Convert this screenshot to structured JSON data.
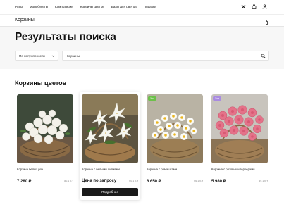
{
  "nav": [
    "Розы",
    "Монобукеты",
    "Композиции",
    "Корзины цветов",
    "Вазы для цветов",
    "Подарки"
  ],
  "search": {
    "query": "Корзины"
  },
  "page_title": "Результаты поиска",
  "filters": {
    "sort_value": "По популярности",
    "query_value": "Корзины"
  },
  "section_title": "Корзины цветов",
  "products": [
    {
      "name": "Корзина белых роз",
      "price": "7 280 ₽",
      "points": "80.1 б.т",
      "badge": "",
      "progress": 0.25
    },
    {
      "name": "Корзина с белыми лилиями",
      "price": "Цена по запросу",
      "points": "60.1 б.т",
      "badge": "",
      "progress": 0.25,
      "button": "Подробнее"
    },
    {
      "name": "Корзина с ромашками",
      "price": "6 650 ₽",
      "points": "66.1 б.т",
      "badge": "Хит",
      "badge_color": "#6cc04a",
      "progress": 0.25
    },
    {
      "name": "Корзина с розовыми герберами",
      "price": "5 980 ₽",
      "points": "49.1 б.т",
      "badge": "Хит",
      "badge_color": "#a98be0",
      "progress": 0.25
    }
  ],
  "icons": [
    "close-icon",
    "bag-icon",
    "user-icon",
    "arrow-right-icon",
    "chevron-down-icon",
    "search-icon"
  ]
}
